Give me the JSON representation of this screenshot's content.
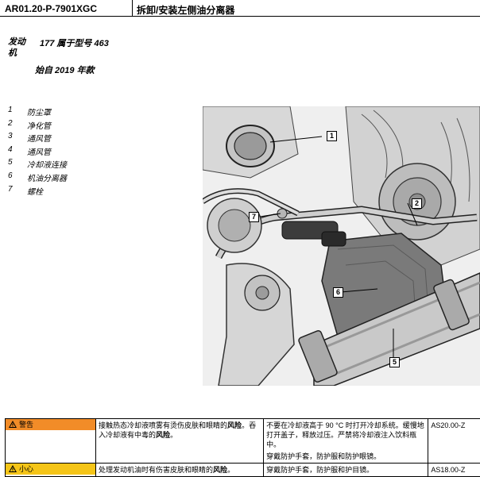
{
  "header": {
    "doc_id": "AR01.20-P-7901XGC",
    "title": "拆卸/安装左侧油分离器"
  },
  "applicability": {
    "label": "发动机",
    "model": "177 属于型号 463",
    "since": "始自 2019 年款"
  },
  "legend": [
    {
      "num": "1",
      "text": "防尘罩"
    },
    {
      "num": "2",
      "text": "净化管"
    },
    {
      "num": "3",
      "text": "通风管"
    },
    {
      "num": "4",
      "text": "通风管"
    },
    {
      "num": "5",
      "text": "冷却液连接"
    },
    {
      "num": "6",
      "text": "机油分离器"
    },
    {
      "num": "7",
      "text": "螺栓"
    }
  ],
  "figure": {
    "callouts": [
      "1",
      "2",
      "7",
      "6",
      "5"
    ]
  },
  "warnings": [
    {
      "level": "警告",
      "hazard_a": "接触热态冷却液喷雾有烫伤皮肤和眼睛的",
      "hazard_b": "风险",
      "hazard_c": "。吞入冷却液有中毒的",
      "hazard_d": "风险",
      "hazard_e": "。",
      "measure_1": "不要在冷却液高于 90 °C 时打开冷却系统。缓慢地打开盖子，释放过压。严禁将冷却液注入饮料瓶中。",
      "measure_2": "穿戴防护手套，防护服和防护眼镜。",
      "ref": "AS20.00-Z"
    },
    {
      "level": "小心",
      "hazard_a": "处理发动机油时有伤害皮肤和眼睛的",
      "hazard_b": "风险",
      "hazard_e": "。",
      "measure_1": "穿戴防护手套，防护服和护目镜。",
      "ref": "AS18.00-Z"
    }
  ]
}
